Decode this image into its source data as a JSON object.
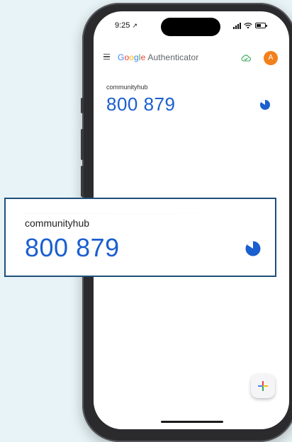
{
  "status_bar": {
    "time": "9:25",
    "location_arrow": "↗"
  },
  "app_bar": {
    "brand_letters": [
      "G",
      "o",
      "o",
      "g",
      "l",
      "e"
    ],
    "app_name": "Authenticator",
    "avatar_letter": "A",
    "icons": [
      "menu-icon",
      "cloud-sync-icon"
    ],
    "colors": {
      "google_blue": "#4285f4",
      "google_red": "#ea4335",
      "google_yellow": "#fbbc05",
      "google_green": "#34a853",
      "avatar": "#f2811d",
      "code": "#1a5fcf"
    }
  },
  "accounts": [
    {
      "name": "communityhub",
      "code": "800 879"
    }
  ],
  "callout": {
    "name": "communityhub",
    "code": "800 879"
  },
  "fab": {
    "icon": "add-icon"
  }
}
